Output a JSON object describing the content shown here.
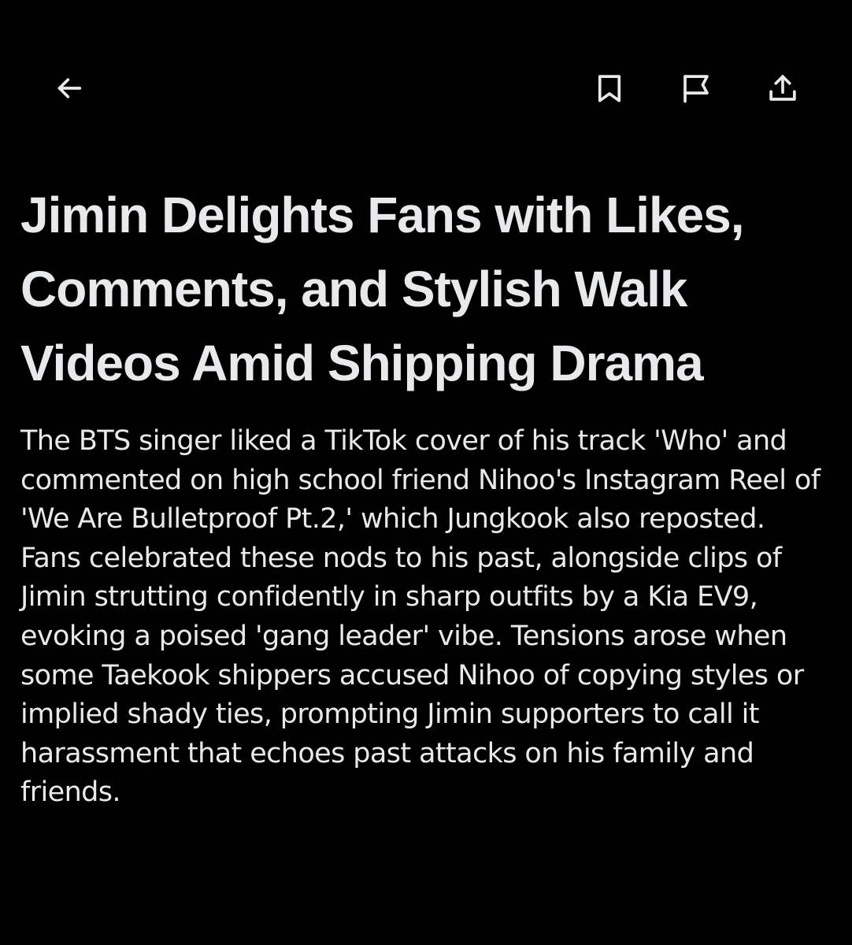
{
  "toolbar": {
    "back_icon": "arrow-left-icon",
    "bookmark_icon": "bookmark-icon",
    "report_icon": "flag-icon",
    "share_icon": "share-icon",
    "icon_color": "#e7e9ea"
  },
  "article": {
    "headline": "Jimin Delights Fans with Likes, Comments, and Stylish Walk Videos Amid Shipping Drama",
    "summary": "The BTS singer liked a TikTok cover of his track 'Who' and commented on high school friend Nihoo's Instagram Reel of 'We Are Bulletproof Pt.2,' which Jungkook also reposted. Fans celebrated these nods to his past, alongside clips of Jimin strutting confidently in sharp outfits by a Kia EV9, evoking a poised 'gang leader' vibe. Tensions arose when some Taekook shippers accused Nihoo of copying styles or implied shady ties, prompting Jimin supporters to call it harassment that echoes past attacks on his family and friends."
  },
  "theme": {
    "background": "#000000",
    "text": "#e7e9ea"
  }
}
